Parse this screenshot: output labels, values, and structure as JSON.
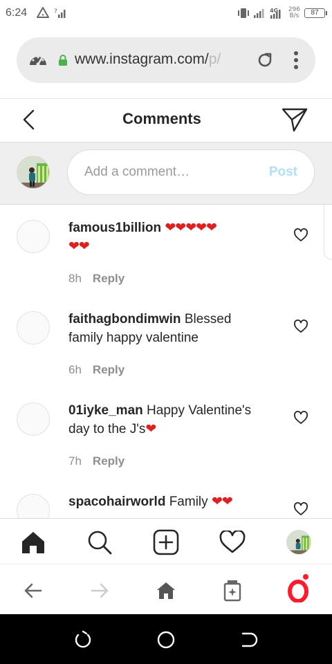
{
  "status_bar": {
    "time": "6:24",
    "network_type": "4G",
    "speed_value": "296",
    "speed_unit": "B/s",
    "battery": "87"
  },
  "browser": {
    "url_main": "www.instagram.com/",
    "url_fade": "p/",
    "icons": [
      "speedometer-icon",
      "lock-icon",
      "reload-icon",
      "more-vertical-icon"
    ]
  },
  "header": {
    "title": "Comments",
    "icons": [
      "back-chevron-icon",
      "send-icon"
    ]
  },
  "add_comment": {
    "placeholder": "Add a comment…",
    "post_label": "Post"
  },
  "comments": [
    {
      "username": "famous1billion",
      "text": "",
      "hearts_line1": "❤❤❤❤❤",
      "hearts_line2": "❤❤",
      "time": "8h",
      "reply_label": "Reply"
    },
    {
      "username": "faithagbondimwin",
      "text": "Blessed",
      "text_line2": "family happy valentine",
      "time": "6h",
      "reply_label": "Reply"
    },
    {
      "username": "01iyke_man",
      "text": "Happy Valentine's",
      "text_line2": "day to the J's",
      "hearts_line2": "❤",
      "time": "7h",
      "reply_label": "Reply"
    },
    {
      "username": "spacohairworld",
      "text": "Family",
      "hearts_line1": "❤❤"
    }
  ],
  "ig_nav": [
    "home-icon",
    "search-icon",
    "new-post-icon",
    "activity-heart-icon",
    "profile-avatar"
  ],
  "browser_nav": [
    "back-arrow-icon",
    "forward-arrow-icon",
    "home-icon",
    "tabs-icon",
    "opera-icon"
  ],
  "colors": {
    "accent_post_disabled": "#b2dffc",
    "heart_red": "#e0201e",
    "opera_red": "#ff1b2d",
    "secure_green": "#4caf50"
  }
}
